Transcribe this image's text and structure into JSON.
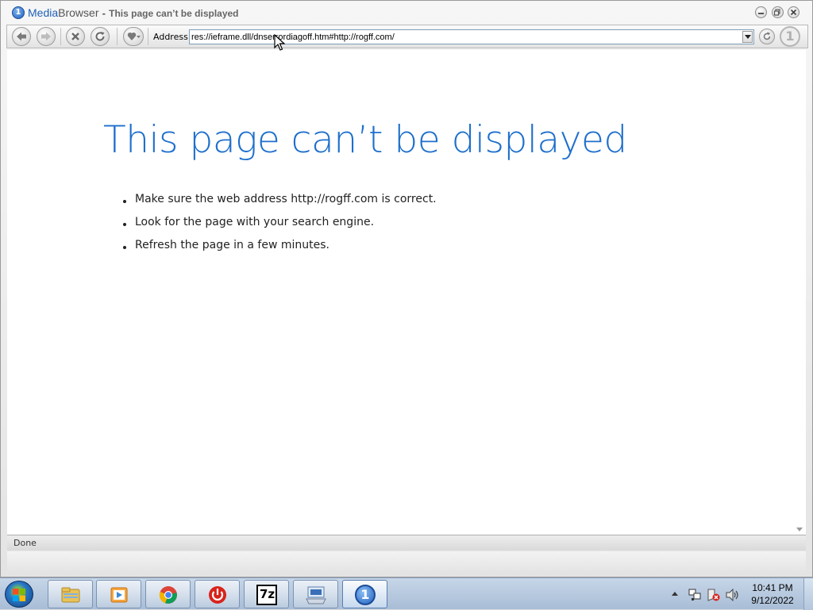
{
  "window": {
    "app_name_part1": "Media",
    "app_name_part2": "Browser",
    "title_separator": "-",
    "page_title": "This page can’t be displayed",
    "app_logo_glyph": "1",
    "controls": [
      "minimize-icon",
      "restore-icon",
      "close-icon"
    ]
  },
  "toolbar": {
    "buttons": [
      "back-icon",
      "forward-icon",
      "stop-icon",
      "refresh-icon",
      "favorites-icon"
    ],
    "address_label": "Address",
    "address_value": "res://ieframe.dll/dnserrordiagoff.htm#http://rogff.com/",
    "go_icon": "go-icon",
    "brand_glyph": "1"
  },
  "page": {
    "heading": "This page can’t be displayed",
    "items": [
      "Make sure the web address http://rogff.com is correct.",
      "Look for the page with your search engine.",
      "Refresh the page in a few minutes."
    ],
    "heading_color": "#1e6fcc"
  },
  "status": {
    "text": "Done"
  },
  "taskbar": {
    "apps": [
      "file-explorer-icon",
      "media-player-icon",
      "chrome-icon",
      "power-icon",
      "7zip-icon",
      "keyboard-icon",
      "media-browser-icon"
    ],
    "sevenzip_label": "7z",
    "browser_glyph": "1",
    "clock_time": "10:41 PM",
    "clock_date": "9/12/2022"
  }
}
